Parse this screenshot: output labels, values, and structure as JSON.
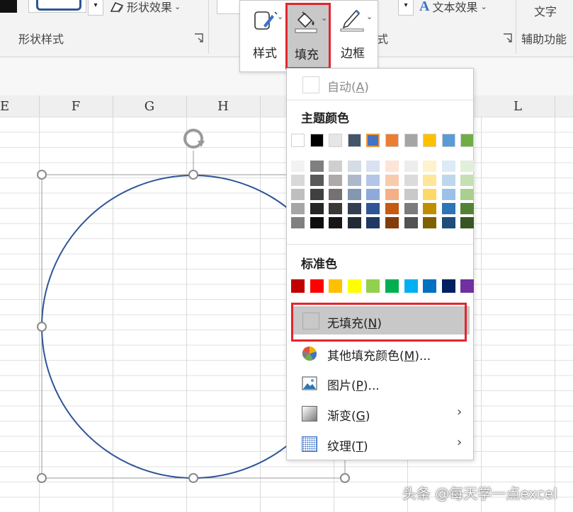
{
  "ribbon": {
    "shape_effects_label": "形状效果",
    "shape_styles_group": "形状样式",
    "text_effects_label": "文本效果",
    "wordart_group_tail": "式",
    "text_label": "文字",
    "accessibility_group": "辅助功能"
  },
  "mini_toolbar": {
    "style_label": "样式",
    "fill_label": "填充",
    "border_label": "边框"
  },
  "columns": [
    "E",
    "F",
    "G",
    "H",
    "L"
  ],
  "menu": {
    "auto_label": "自动(",
    "auto_key": "A",
    "auto_close": ")",
    "theme_title": "主题颜色",
    "theme_colors": [
      "#ffffff",
      "#000000",
      "#e7e6e6",
      "#44546a",
      "#4472c4",
      "#ed7d31",
      "#a5a5a5",
      "#ffc000",
      "#5b9bd5",
      "#70ad47"
    ],
    "theme_shades": [
      [
        "#f2f2f2",
        "#d9d9d9",
        "#bfbfbf",
        "#a6a6a6",
        "#808080"
      ],
      [
        "#7f7f7f",
        "#595959",
        "#404040",
        "#262626",
        "#0d0d0d"
      ],
      [
        "#d0cece",
        "#aeaaaa",
        "#757171",
        "#3b3838",
        "#171616"
      ],
      [
        "#d6dce4",
        "#adb9ca",
        "#8497b0",
        "#333f4f",
        "#222a35"
      ],
      [
        "#d9e1f2",
        "#b4c6e7",
        "#8ea9db",
        "#2f5597",
        "#1f3864"
      ],
      [
        "#fce4d6",
        "#f8cbad",
        "#f4b084",
        "#c55a11",
        "#833c0b"
      ],
      [
        "#ededed",
        "#dbdbdb",
        "#c9c9c9",
        "#7b7b7b",
        "#525252"
      ],
      [
        "#fff2cc",
        "#ffe699",
        "#ffd966",
        "#bf8f00",
        "#7f6000"
      ],
      [
        "#ddebf7",
        "#bdd7ee",
        "#9bc2e6",
        "#2e75b6",
        "#1f4e78"
      ],
      [
        "#e2efda",
        "#c6e0b4",
        "#a9d08e",
        "#548235",
        "#375623"
      ]
    ],
    "standard_title": "标准色",
    "standard_colors": [
      "#c00000",
      "#ff0000",
      "#ffc000",
      "#ffff00",
      "#92d050",
      "#00b050",
      "#00b0f0",
      "#0070c0",
      "#002060",
      "#7030a0"
    ],
    "no_fill_label": "无填充(",
    "no_fill_key": "N",
    "no_fill_close": ")",
    "more_colors_label": "其他填充颜色(",
    "more_colors_key": "M",
    "more_colors_close": ")...",
    "picture_label": "图片(",
    "picture_key": "P",
    "picture_close": ")...",
    "gradient_label": "渐变(",
    "gradient_key": "G",
    "gradient_close": ")",
    "texture_label": "纹理(",
    "texture_key": "T",
    "texture_close": ")"
  },
  "watermark": "头条 @每天学一点excel",
  "colors": {
    "highlight_red": "#e1262d",
    "shape_outline": "#2f5597",
    "selected_item_bg": "#c8c8c8"
  }
}
